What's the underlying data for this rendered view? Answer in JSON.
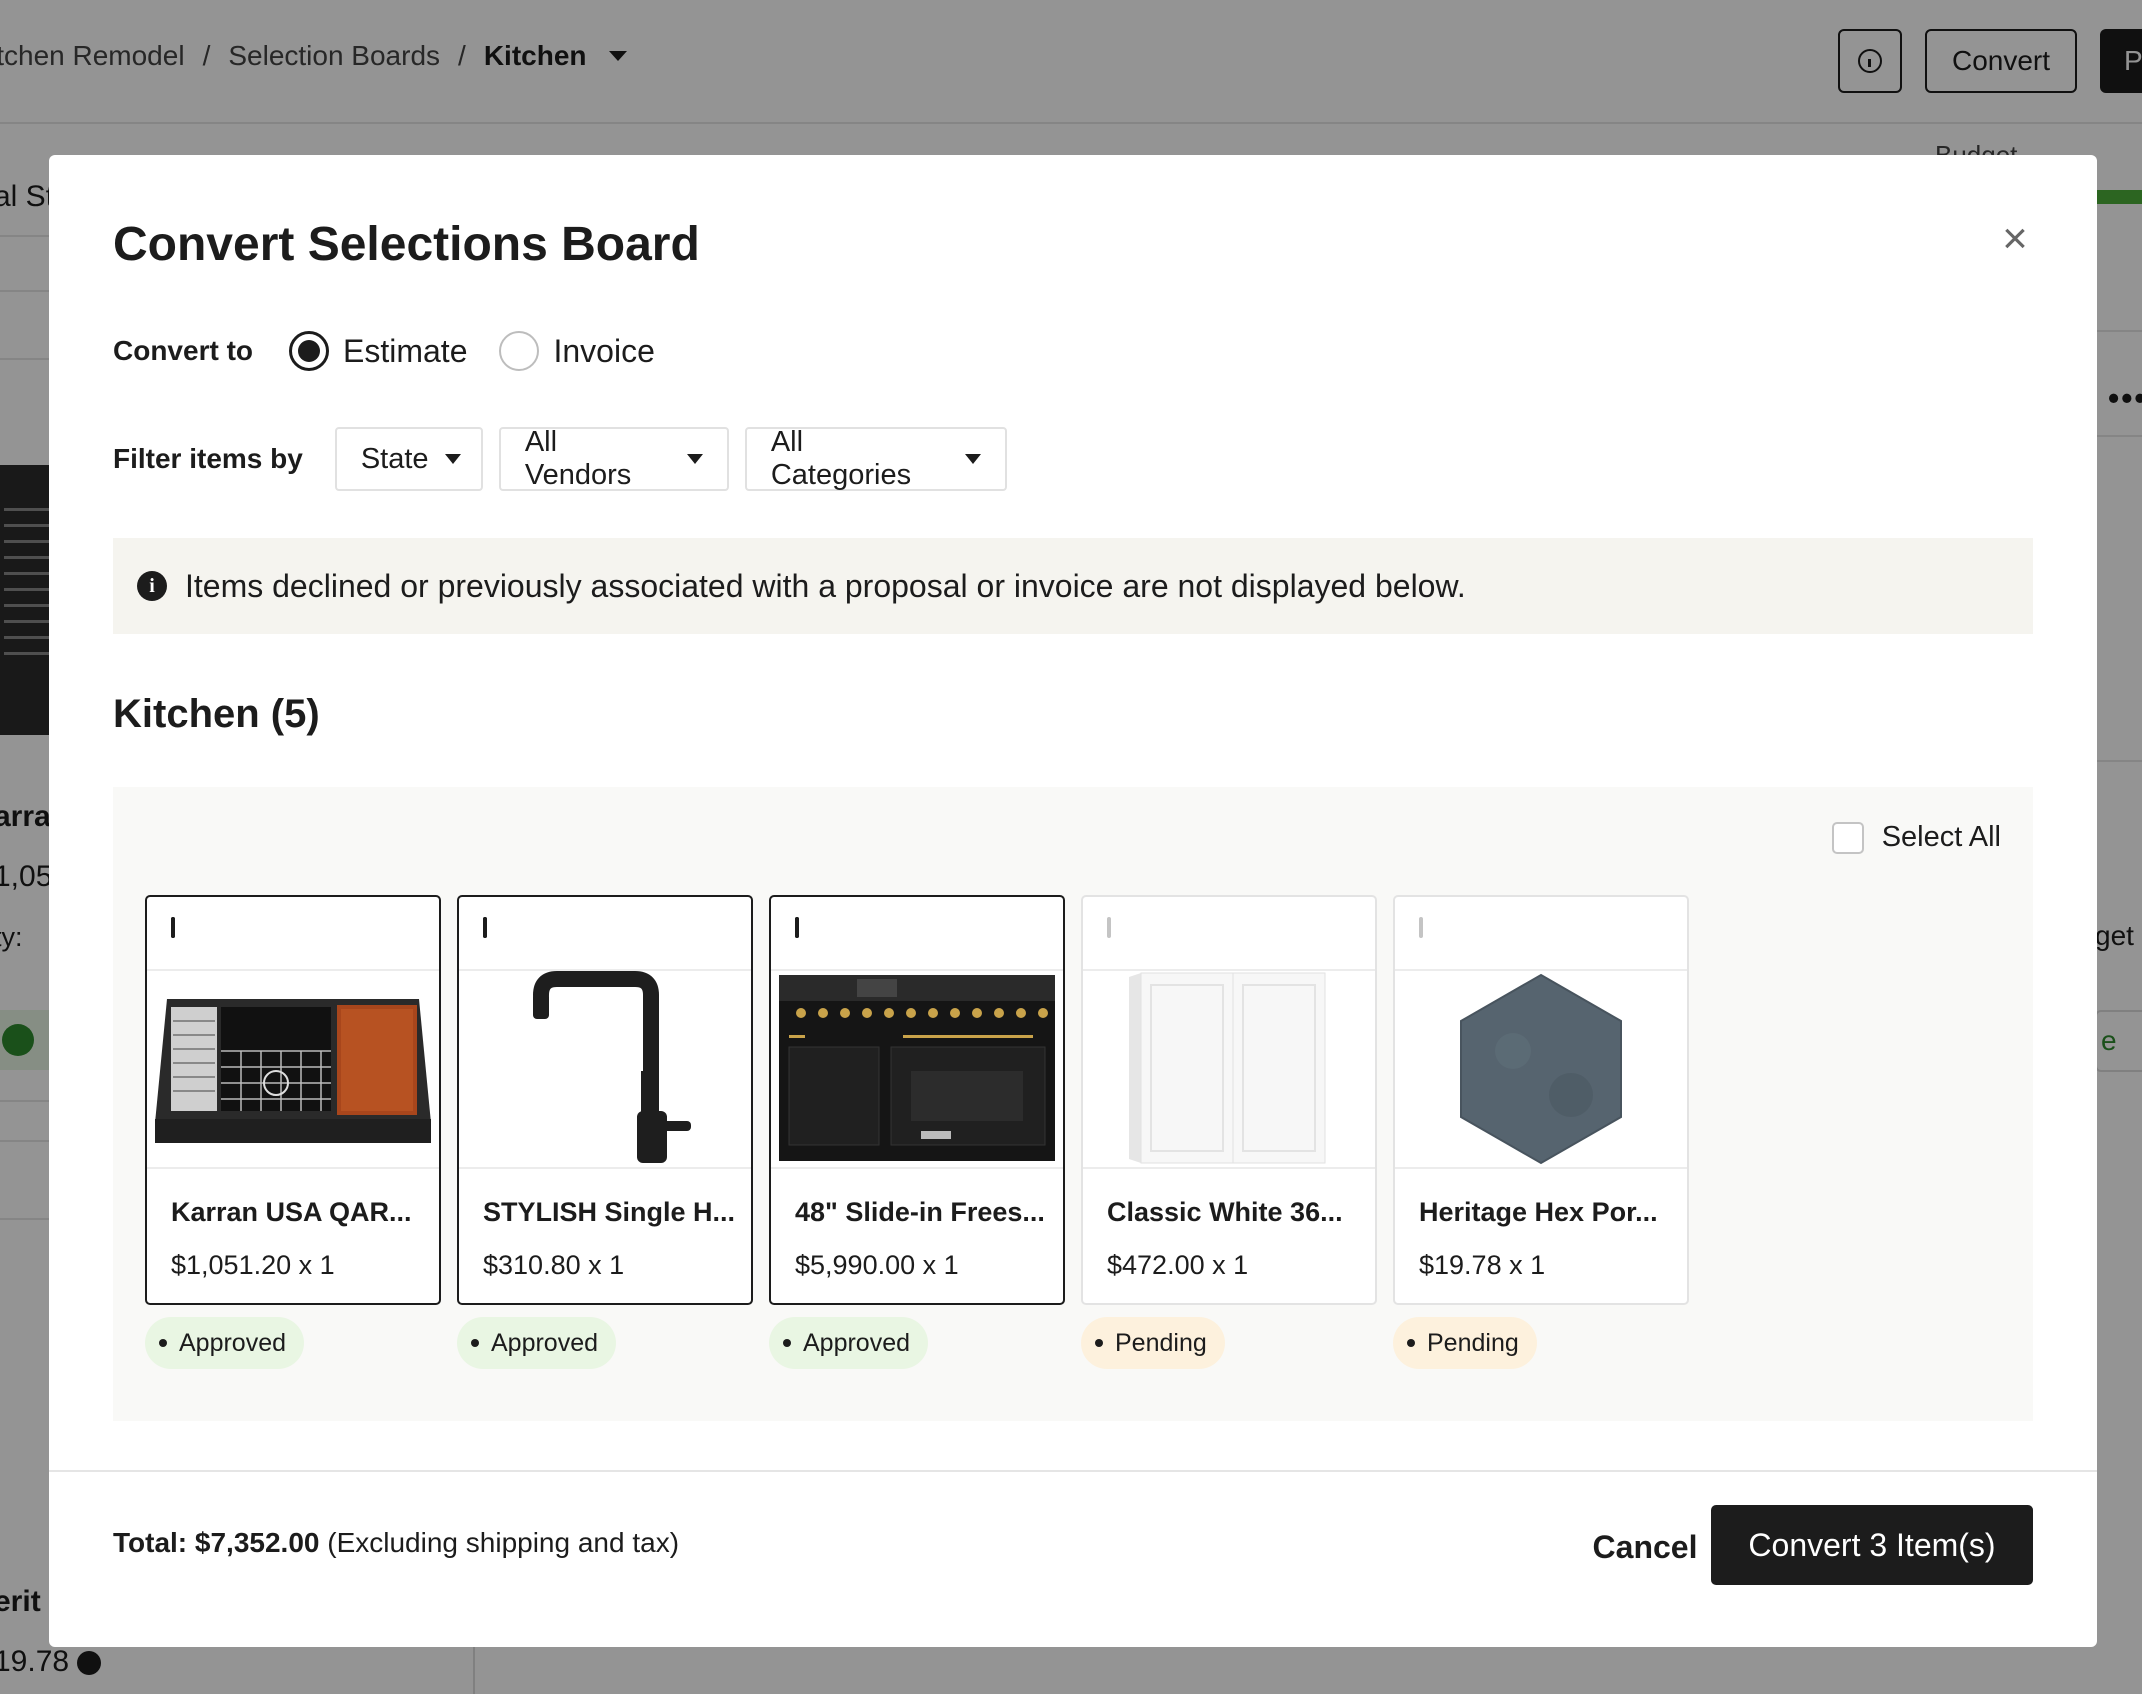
{
  "background": {
    "breadcrumb": [
      "itchen Remodel",
      "Selection Boards",
      "Kitchen"
    ],
    "breadcrumb_sep": "/",
    "toolbar": {
      "convert_label": "Convert",
      "primary_fragment": "P"
    },
    "budget_label": "Budget",
    "left_fragments": [
      "al St",
      "arra",
      "1,05",
      "ty:",
      "erit",
      "19.78"
    ],
    "right_fragments": {
      "get": "get",
      "btn": "e",
      "more": "•••"
    }
  },
  "modal": {
    "title": "Convert Selections Board",
    "close_icon": "close-icon",
    "convert_to": {
      "label": "Convert to",
      "options": [
        {
          "label": "Estimate",
          "selected": true
        },
        {
          "label": "Invoice",
          "selected": false
        }
      ]
    },
    "filter": {
      "label": "Filter items by",
      "state": "State",
      "vendors": "All Vendors",
      "categories": "All Categories"
    },
    "notice": "Items declined or previously associated with a proposal or invoice are not displayed below.",
    "section_title": "Kitchen (5)",
    "select_all": "Select All",
    "items": [
      {
        "name": "Karran USA QAR...",
        "price": "$1,051.20 x 1",
        "status": "Approved",
        "checked": true,
        "icon": "sink-image"
      },
      {
        "name": "STYLISH Single H...",
        "price": "$310.80 x 1",
        "status": "Approved",
        "checked": true,
        "icon": "faucet-image"
      },
      {
        "name": "48\" Slide-in Frees...",
        "price": "$5,990.00 x 1",
        "status": "Approved",
        "checked": true,
        "icon": "range-image"
      },
      {
        "name": "Classic White 36...",
        "price": "$472.00 x 1",
        "status": "Pending",
        "checked": false,
        "icon": "cabinet-image"
      },
      {
        "name": "Heritage Hex Por...",
        "price": "$19.78 x 1",
        "status": "Pending",
        "checked": false,
        "icon": "hex-tile-image"
      }
    ],
    "footer": {
      "total_label": "Total: $7,352.00",
      "total_note": "(Excluding shipping and tax)",
      "cancel": "Cancel",
      "convert": "Convert 3 Item(s)"
    },
    "colors": {
      "approved_bg": "#e9f6e3",
      "pending_bg": "#fdf1dd",
      "primary": "#1c1c1c"
    }
  }
}
